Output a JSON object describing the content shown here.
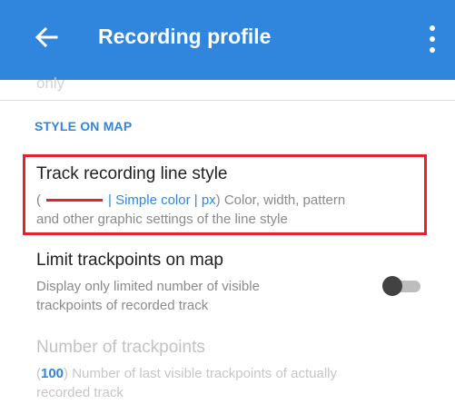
{
  "appbar": {
    "title": "Recording profile",
    "back_icon": "arrow-left-icon",
    "menu_icon": "more-vertical-icon"
  },
  "cutoff_text": "only",
  "section": {
    "header": "STYLE ON MAP"
  },
  "prefs": {
    "line_style": {
      "title": "Track recording line style",
      "summary_open": "(",
      "summary_accent": "| Simple color | px",
      "summary_rest_line1": ") Color, width, pattern",
      "summary_line2": "and other graphic settings of the line style"
    },
    "limit_trackpoints": {
      "title": "Limit trackpoints on map",
      "summary_line1": "Display only limited number of visible",
      "summary_line2": "trackpoints of recorded track",
      "toggle_on": false
    },
    "number_trackpoints": {
      "title": "Number of trackpoints",
      "summary_open": "(",
      "summary_value": "100",
      "summary_rest_line1": ") Number of last visible trackpoints of actually",
      "summary_line2": "recorded track"
    }
  },
  "colors": {
    "appbar": "#2f86dc",
    "accent": "#2f86dc",
    "highlight": "#e2232a",
    "line_sample": "#e2232a"
  }
}
